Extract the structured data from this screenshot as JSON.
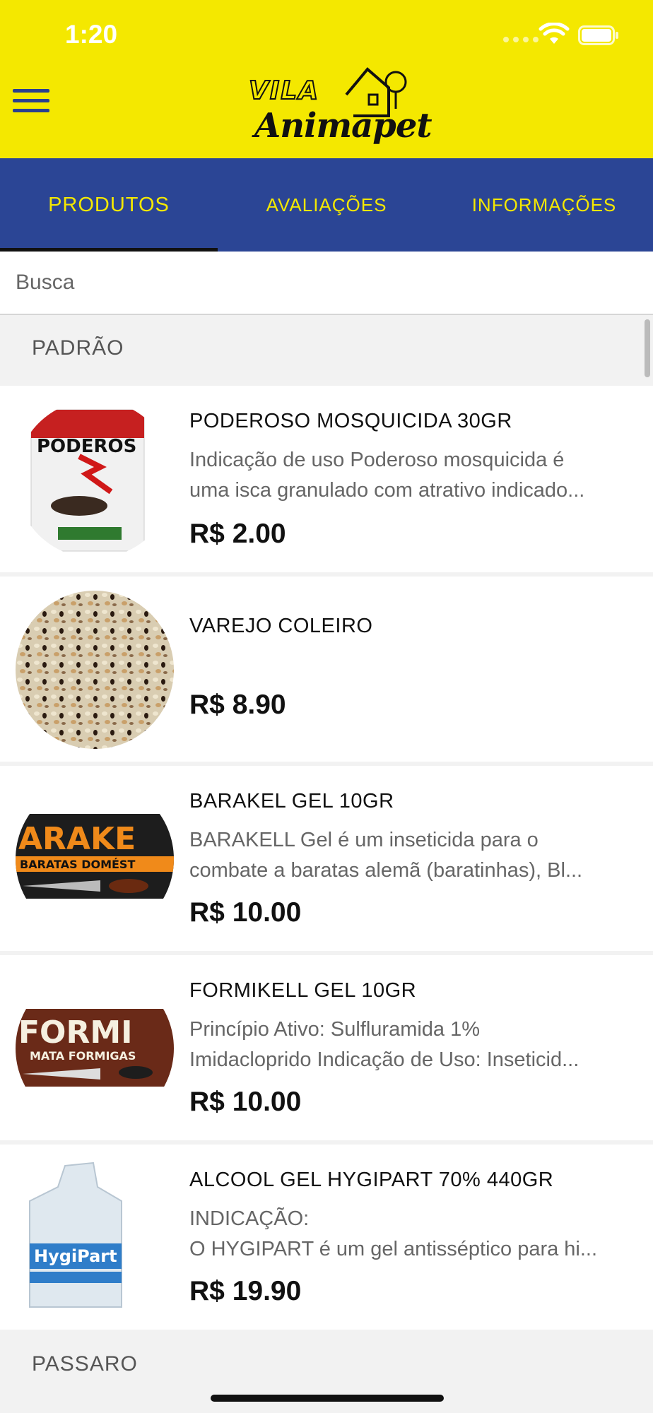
{
  "status": {
    "time": "1:20"
  },
  "header": {
    "logo_line1": "VILA",
    "logo_line2": "Animapet"
  },
  "tabs": [
    {
      "label": "PRODUTOS"
    },
    {
      "label": "AVALIAÇÕES"
    },
    {
      "label": "INFORMAÇÕES"
    }
  ],
  "search": {
    "placeholder": "Busca"
  },
  "sections": [
    {
      "title": "PADRÃO"
    },
    {
      "title": "PASSARO"
    }
  ],
  "products": [
    {
      "title": "PODEROSO MOSQUICIDA 30GR",
      "desc1": "Indicação de uso Poderoso mosquicida é",
      "desc2": "uma isca granulado com atrativo indicado...",
      "price": "R$ 2.00",
      "image": "insecticide-box-icon"
    },
    {
      "title": "VAREJO COLEIRO",
      "desc1": "",
      "desc2": "",
      "price": "R$ 8.90",
      "image": "bird-seed-icon"
    },
    {
      "title": "BARAKEL GEL 10GR",
      "desc1": "BARAKELL Gel é um inseticida para o",
      "desc2": "combate a baratas alemã (baratinhas), Bl...",
      "price": "R$ 10.00",
      "image": "cockroach-gel-icon"
    },
    {
      "title": "FORMIKELL GEL 10GR",
      "desc1": "Princípio Ativo: Sulfluramida 1%",
      "desc2": "Imidacloprido Indicação de Uso: Inseticid...",
      "price": "R$ 10.00",
      "image": "ant-gel-icon"
    },
    {
      "title": "ALCOOL GEL HYGIPART 70% 440GR",
      "desc1": "INDICAÇÃO:",
      "desc2": "O HYGIPART é um gel antisséptico para hi...",
      "price": "R$ 19.90",
      "image": "alcohol-gel-bottle-icon"
    }
  ],
  "colors": {
    "brand_yellow": "#f4e800",
    "tab_blue": "#2b4595"
  }
}
